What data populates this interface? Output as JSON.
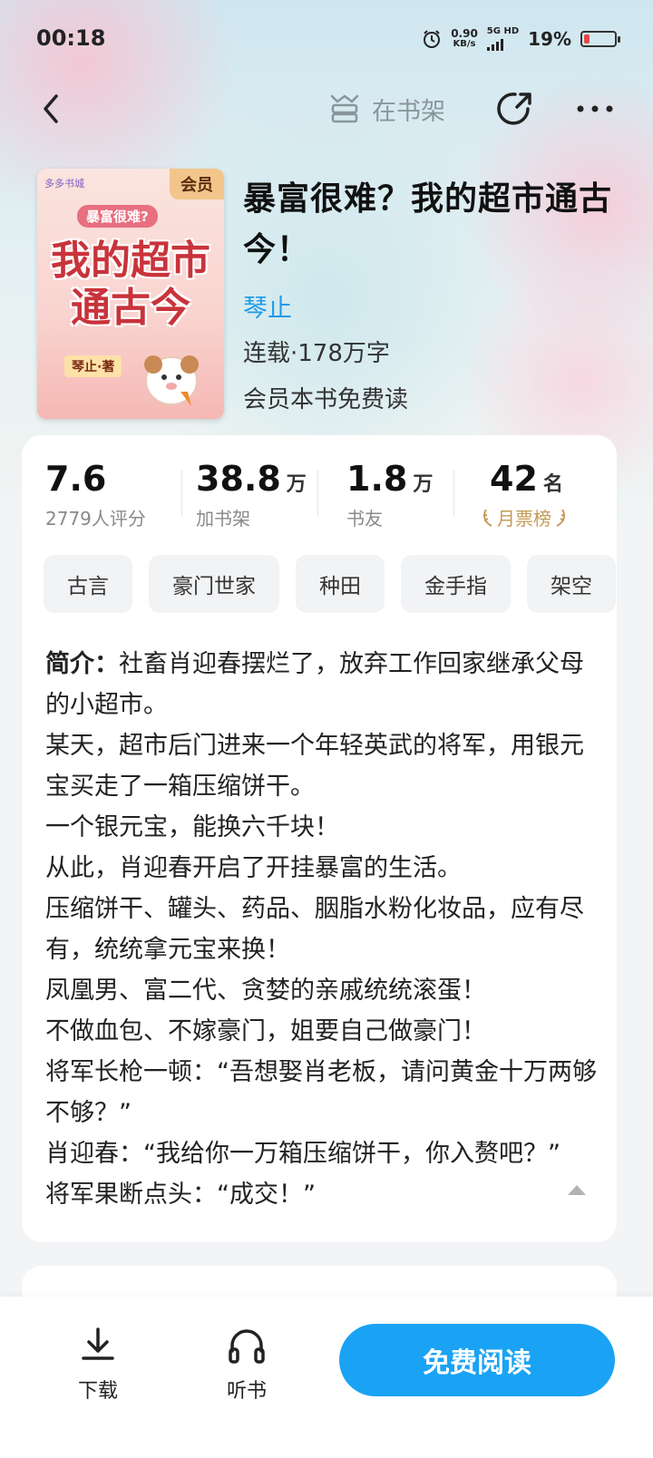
{
  "status_bar": {
    "time": "00:18",
    "net_speed_value": "0.90",
    "net_speed_unit": "KB/s",
    "network": "5G HD",
    "battery": "19%",
    "battery_level": 0.19,
    "battery_color": "#e24a4a"
  },
  "nav": {
    "shelf_label": "在书架"
  },
  "cover": {
    "logo": "多多书城",
    "vip": "会员",
    "subtitle": "暴富很难?",
    "title": "我的超市通古今",
    "author": "琴止·著"
  },
  "book": {
    "title": "暴富很难？我的超市通古今！",
    "author": "琴止",
    "meta": "连载·178万字",
    "free_note": "会员本书免费读"
  },
  "stats": {
    "rating": {
      "value": "7.6",
      "label": "2779人评分"
    },
    "shelf": {
      "value": "38.8",
      "unit": "万",
      "label": "加书架"
    },
    "fans": {
      "value": "1.8",
      "unit": "万",
      "label": "书友"
    },
    "rank": {
      "value": "42",
      "unit": "名",
      "label": "月票榜"
    }
  },
  "tags": [
    "古言",
    "豪门世家",
    "种田",
    "金手指",
    "架空"
  ],
  "intro": {
    "lead": "简介：",
    "first_line": "社畜肖迎春摆烂了，放弃工作回家继承父母的小超市。",
    "lines": [
      "某天，超市后门进来一个年轻英武的将军，用银元宝买走了一箱压缩饼干。",
      "一个银元宝，能换六千块！",
      "从此，肖迎春开启了开挂暴富的生活。",
      "压缩饼干、罐头、药品、胭脂水粉化妆品，应有尽有，统统拿元宝来换！",
      "凤凰男、富二代、贪婪的亲戚统统滚蛋！",
      "不做血包、不嫁豪门，姐要自己做豪门！",
      "将军长枪一顿：“吾想娶肖老板，请问黄金十万两够不够？”",
      "肖迎春：“我给你一万箱压缩饼干，你入赘吧？”",
      "将军果断点头：“成交！”"
    ]
  },
  "bottom": {
    "download": "下载",
    "listen": "听书",
    "read": "免费阅读"
  },
  "colors": {
    "accent": "#1aa3f5",
    "author_link": "#1e9be8",
    "rank_gold": "#c59a55"
  }
}
